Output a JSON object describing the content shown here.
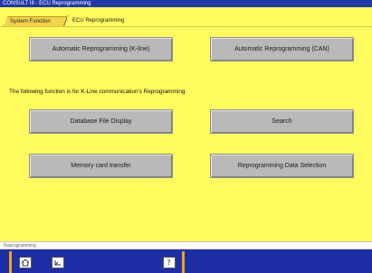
{
  "window": {
    "title": "CONSULT III - ECU Reprogramming"
  },
  "tabs": [
    {
      "label": "System Function"
    },
    {
      "label": "ECU Reprogramming"
    }
  ],
  "buttons": {
    "auto_kline": "Automatic Reprogramming (K-line)",
    "auto_can": "Automatic Reprogramming (CAN)",
    "db_file_display": "Database File Display",
    "search": "Search",
    "memory_card_transfer": "Memory card transfer",
    "data_selection": "Reprogramming Data Selection"
  },
  "info": {
    "text": "The following function is for K-Line communication's Reprogramming."
  },
  "status": {
    "text": "Reprogramming"
  },
  "toolbar": {
    "home_icon": "home-icon",
    "back_icon": "back-icon",
    "help_icon": "help-icon",
    "help_glyph": "?"
  },
  "colors": {
    "background": "#fffb5e",
    "button": "#b9b9b9",
    "bar": "#1e2ea4",
    "accent": "#f0a419"
  }
}
